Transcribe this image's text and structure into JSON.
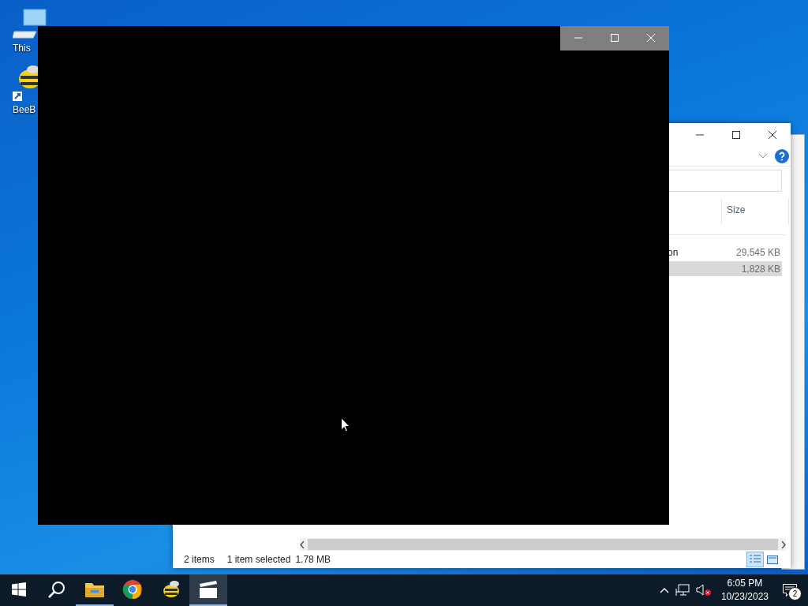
{
  "desktop_icons": [
    {
      "kind": "computer",
      "label": "This"
    },
    {
      "kind": "bee",
      "label": "BeeB"
    }
  ],
  "explorer": {
    "column_header": "Size",
    "rows": [
      {
        "name": "on",
        "size": "29,545 KB",
        "selected": false
      },
      {
        "size": "1,828 KB",
        "selected": true
      }
    ],
    "status_bar": {
      "items": "2 items",
      "selection": "1 item selected",
      "size": "1.78 MB"
    },
    "view_buttons": [
      {
        "kind": "details",
        "selected": true
      },
      {
        "kind": "tiles",
        "selected": false
      }
    ]
  },
  "taskbar": {
    "apps": [
      {
        "kind": "explorer",
        "running": true,
        "active": false
      },
      {
        "kind": "chrome",
        "running": false,
        "active": false
      },
      {
        "kind": "bee",
        "running": false,
        "active": false
      },
      {
        "kind": "clapper",
        "running": true,
        "active": true
      }
    ],
    "time": "6:05 PM",
    "date": "10/23/2023",
    "notification_count": "2"
  }
}
